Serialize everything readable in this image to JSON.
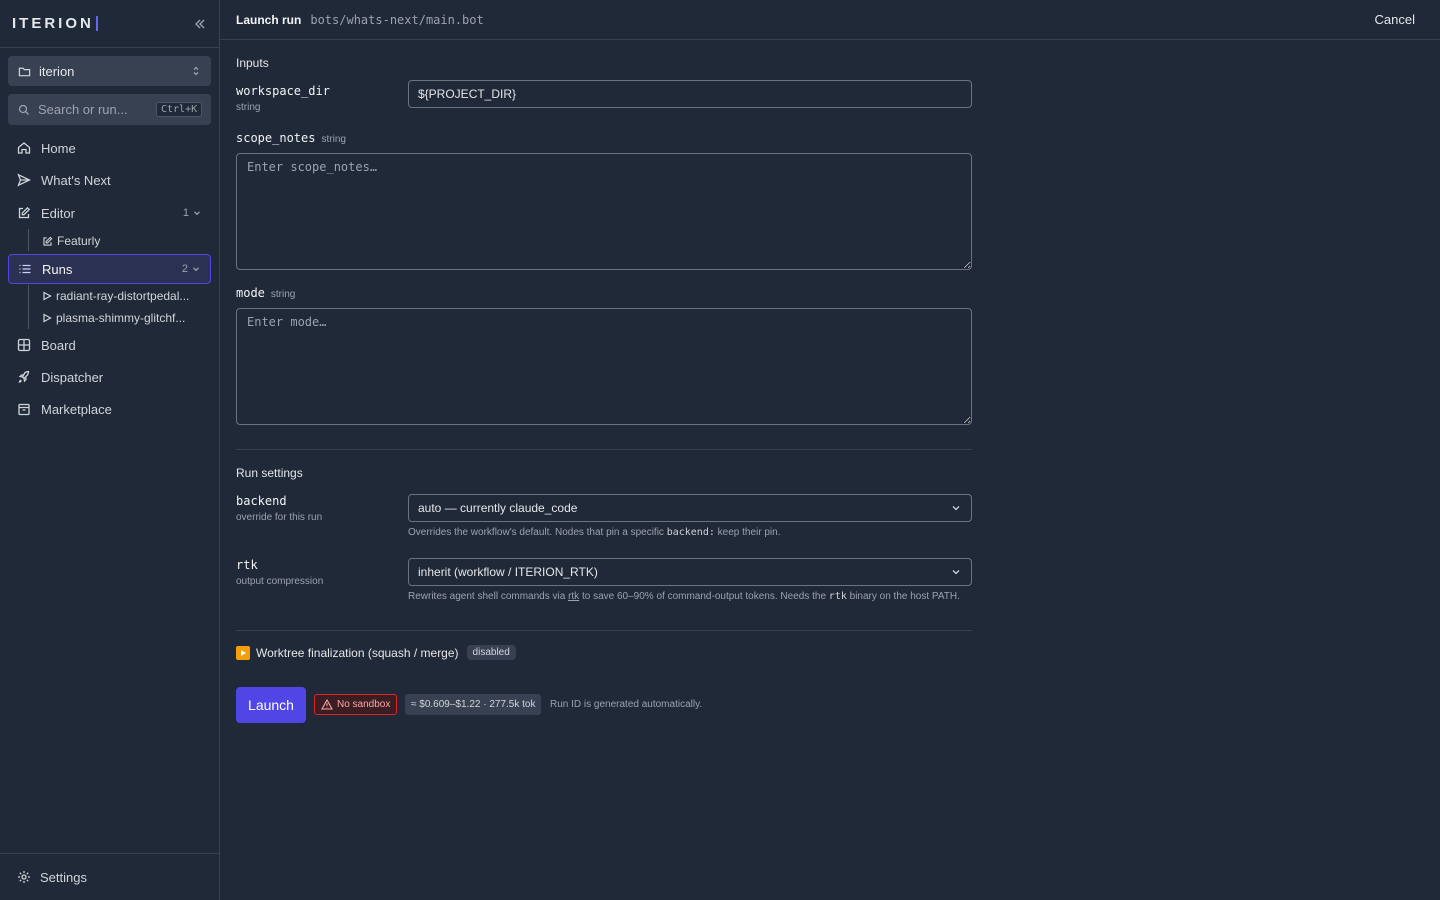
{
  "brand": "ITERION",
  "workspace": {
    "name": "iterion"
  },
  "search": {
    "placeholder": "Search or run...",
    "shortcut": "Ctrl+K"
  },
  "nav": {
    "home": "Home",
    "whats_next": "What's Next",
    "editor": {
      "label": "Editor",
      "count": "1"
    },
    "editor_children": [
      "Featurly"
    ],
    "runs": {
      "label": "Runs",
      "count": "2"
    },
    "runs_children": [
      "radiant-ray-distortpedal...",
      "plasma-shimmy-glitchf..."
    ],
    "board": "Board",
    "dispatcher": "Dispatcher",
    "marketplace": "Marketplace",
    "settings": "Settings"
  },
  "topbar": {
    "title": "Launch run",
    "path": "bots/whats-next/main.bot",
    "cancel": "Cancel"
  },
  "inputs": {
    "heading": "Inputs",
    "workspace_dir": {
      "label": "workspace_dir",
      "type": "string",
      "value": "${PROJECT_DIR}"
    },
    "scope_notes": {
      "label": "scope_notes",
      "type": "string",
      "placeholder": "Enter scope_notes…"
    },
    "mode": {
      "label": "mode",
      "type": "string",
      "placeholder": "Enter mode…"
    }
  },
  "run_settings": {
    "heading": "Run settings",
    "backend": {
      "label": "backend",
      "sub": "override for this run",
      "value": "auto — currently claude_code",
      "help_pre": "Overrides the workflow's default. Nodes that pin a specific",
      "help_code": "backend:",
      "help_post": "keep their pin."
    },
    "rtk": {
      "label": "rtk",
      "sub": "output compression",
      "value": "inherit (workflow / ITERION_RTK)",
      "help_pre": "Rewrites agent shell commands via",
      "help_link": "rtk",
      "help_mid": "to save 60–90% of command-output tokens. Needs the",
      "help_code": "rtk",
      "help_post": "binary on the host PATH."
    }
  },
  "worktree": {
    "label": "Worktree finalization (squash / merge)",
    "badge": "disabled"
  },
  "footer": {
    "launch": "Launch",
    "no_sandbox": "No sandbox",
    "cost": "≈ $0.609–$1.22 · 277.5k tok",
    "run_id_note": "Run ID is generated automatically."
  },
  "colors": {
    "accent": "#4f46e5",
    "background": "#1f2937",
    "danger": "#dc2626",
    "warning": "#f59e0b"
  }
}
